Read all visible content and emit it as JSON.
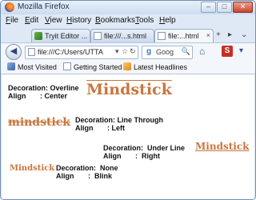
{
  "window": {
    "title": "Mozilla Firefox",
    "controls": {
      "minimize": "–",
      "maximize": "□",
      "close": "✕"
    }
  },
  "menubar": {
    "items": [
      {
        "mnemonic": "F",
        "rest": "ile"
      },
      {
        "mnemonic": "E",
        "rest": "dit"
      },
      {
        "mnemonic": "V",
        "rest": "iew"
      },
      {
        "mnemonic": "H",
        "rest": "istory"
      },
      {
        "mnemonic": "B",
        "rest": "ookmarks"
      },
      {
        "mnemonic": "T",
        "rest": "ools"
      },
      {
        "mnemonic": "H",
        "rest": "elp"
      }
    ]
  },
  "tabs": {
    "items": [
      {
        "label": "Tryit Editor ...",
        "favicon": "tryit-favicon",
        "active": false
      },
      {
        "label": "file:///...s.html",
        "favicon": "page-favicon",
        "active": false
      },
      {
        "label": "file:...html",
        "favicon": "page-favicon",
        "active": true
      }
    ],
    "close_glyph": "×",
    "new_tab": "+",
    "scroll_right": "▸",
    "list_tabs": "⌄"
  },
  "navbar": {
    "back": "◀",
    "url": "file:///C:/Users/UTTA",
    "url_dropdown": "▾",
    "bookmark_star": "☆",
    "reload": "↻",
    "search_engine": "g",
    "search_placeholder": "Goog",
    "search_go": "🔍",
    "home": "⌂",
    "extension_label": "S",
    "downloads": "▾"
  },
  "bookmarks": {
    "items": [
      "Most Visited",
      "Getting Started",
      "Latest Headlines"
    ]
  },
  "content": {
    "blocks": [
      {
        "decoration_label": "Decoration: Overline",
        "align_label": "Align       : Center",
        "text": "Mindstick",
        "decoration": "overline"
      },
      {
        "decoration_label": "Decoration: Line Through",
        "align_label": "Align       : Left",
        "text": "mindstick",
        "decoration": "line-through"
      },
      {
        "decoration_label": "Decoration:  Under Line",
        "align_label": "Align       :  Right",
        "text": "Mindstick",
        "decoration": "underline"
      },
      {
        "decoration_label": "Decoration:  None",
        "align_label": "Align       :  Blink",
        "text": "Mindstick",
        "decoration": "none"
      }
    ],
    "text_color": "#c8763e"
  }
}
